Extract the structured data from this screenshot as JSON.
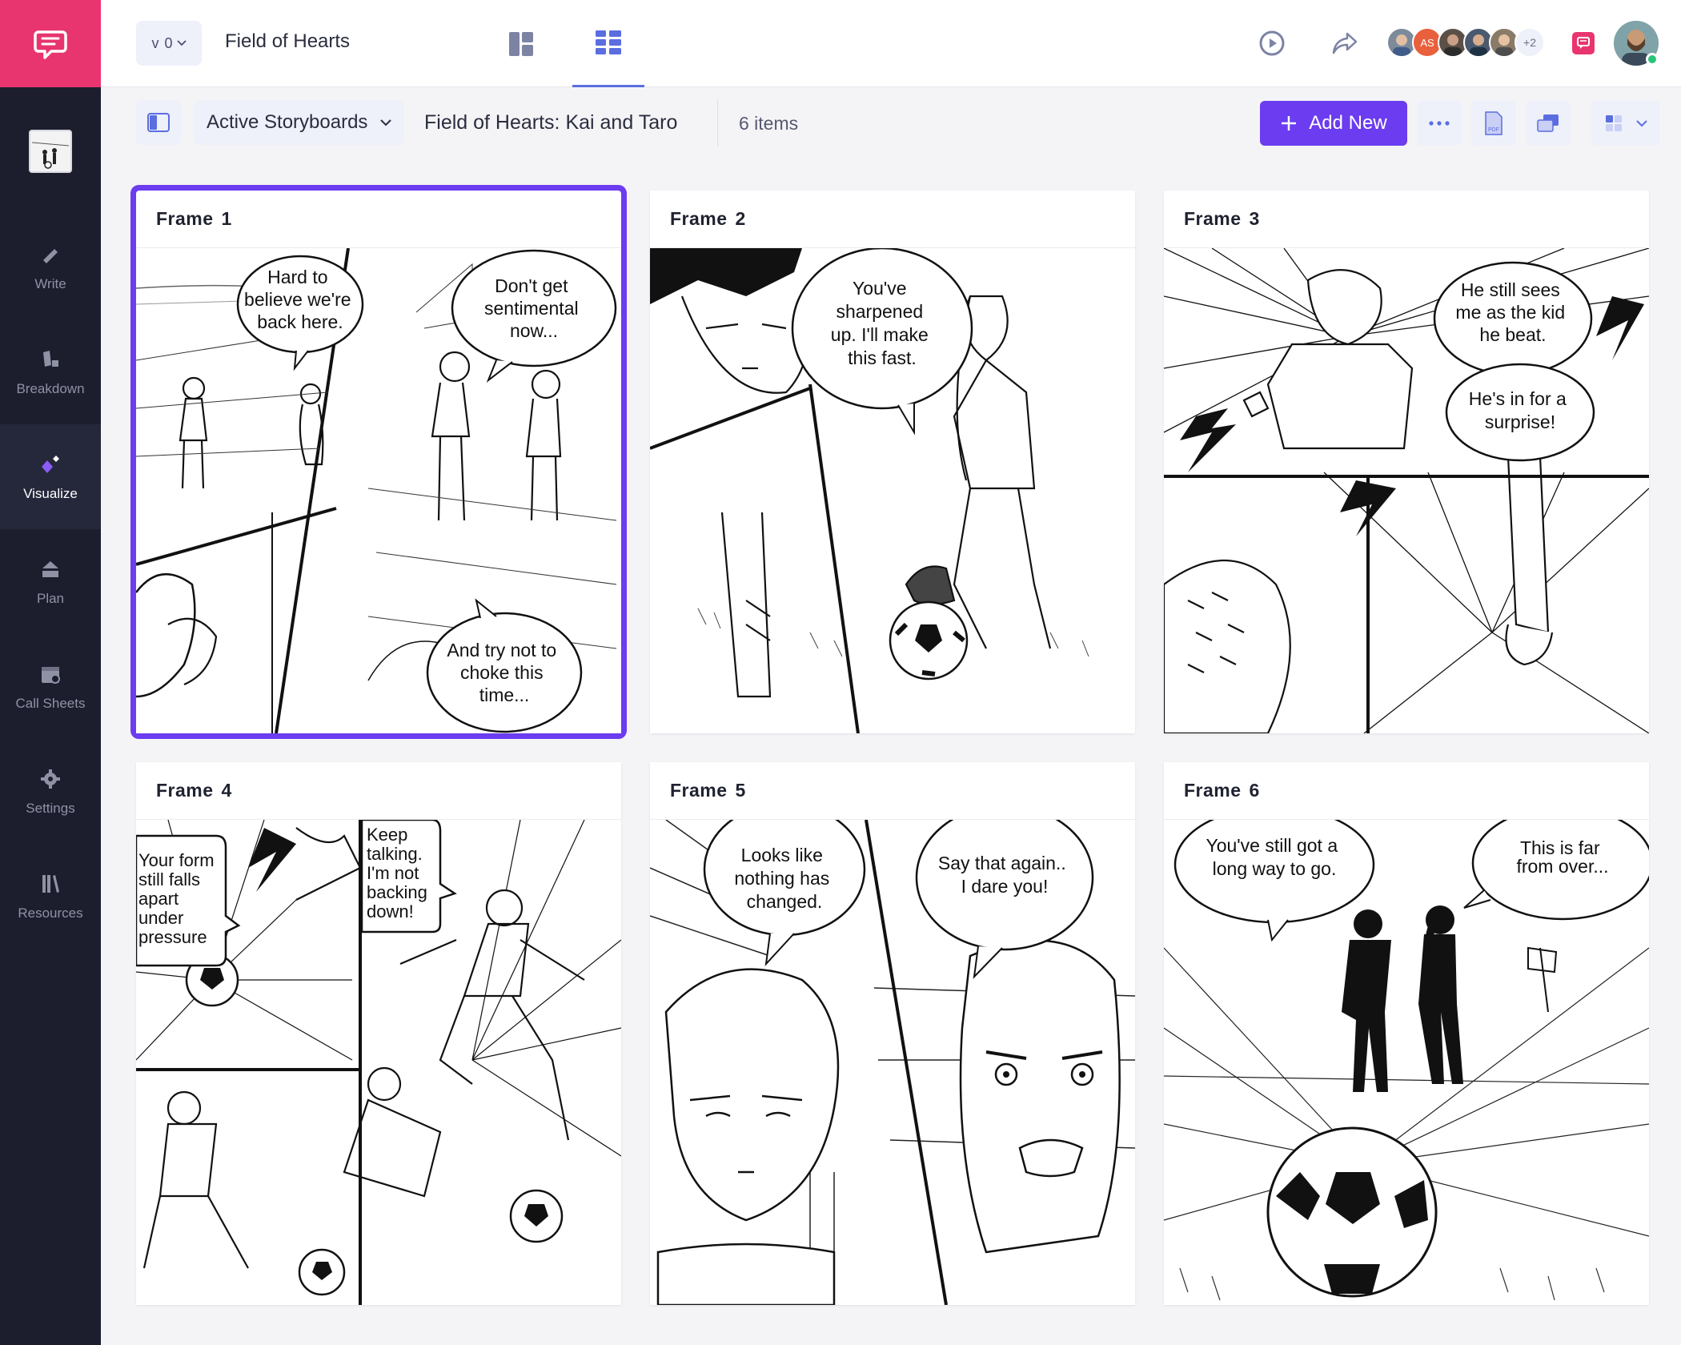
{
  "sidebar": {
    "items": [
      {
        "label": "Write",
        "icon": "pencil-icon"
      },
      {
        "label": "Breakdown",
        "icon": "breakdown-icon"
      },
      {
        "label": "Visualize",
        "icon": "visualize-icon",
        "active": true
      },
      {
        "label": "Plan",
        "icon": "plan-icon"
      },
      {
        "label": "Call Sheets",
        "icon": "calendar-icon"
      },
      {
        "label": "Settings",
        "icon": "gear-icon"
      },
      {
        "label": "Resources",
        "icon": "books-icon"
      }
    ]
  },
  "topbar": {
    "version": "v 0",
    "project_title": "Field of Hearts",
    "collaborator_initials": "AS",
    "collaborators_more": "+2"
  },
  "toolbar": {
    "dropdown_label": "Active Storyboards",
    "storyboard_title": "Field of Hearts: Kai and Taro",
    "item_count": "6 items",
    "add_new_label": "Add New"
  },
  "accent_color": "#6b3cf0",
  "frames": [
    {
      "label": "Frame",
      "number": "1",
      "bubbles": [
        [
          "Hard to",
          "believe we're",
          "back here."
        ],
        [
          "Don't get",
          "sentimental",
          "now..."
        ],
        [
          "And try not to",
          "choke this",
          "time..."
        ]
      ]
    },
    {
      "label": "Frame",
      "number": "2",
      "bubbles": [
        [
          "You've",
          "sharpened",
          "up. I'll make",
          "this fast."
        ]
      ]
    },
    {
      "label": "Frame",
      "number": "3",
      "bubbles": [
        [
          "He still sees",
          "me as the kid",
          "he beat."
        ],
        [
          "He's in for a",
          "surprise!"
        ]
      ]
    },
    {
      "label": "Frame",
      "number": "4",
      "bubbles": [
        [
          "Your form",
          "still falls",
          "apart",
          "under",
          "pressure"
        ],
        [
          "Keep",
          "talking.",
          "I'm not",
          "backing",
          "down!"
        ]
      ]
    },
    {
      "label": "Frame",
      "number": "5",
      "bubbles": [
        [
          "Looks like",
          "nothing has",
          "changed."
        ],
        [
          "Say that again..",
          "I dare you!"
        ]
      ]
    },
    {
      "label": "Frame",
      "number": "6",
      "bubbles": [
        [
          "You've still got a",
          "long way to go."
        ],
        [
          "This is far",
          "from over..."
        ]
      ]
    }
  ]
}
